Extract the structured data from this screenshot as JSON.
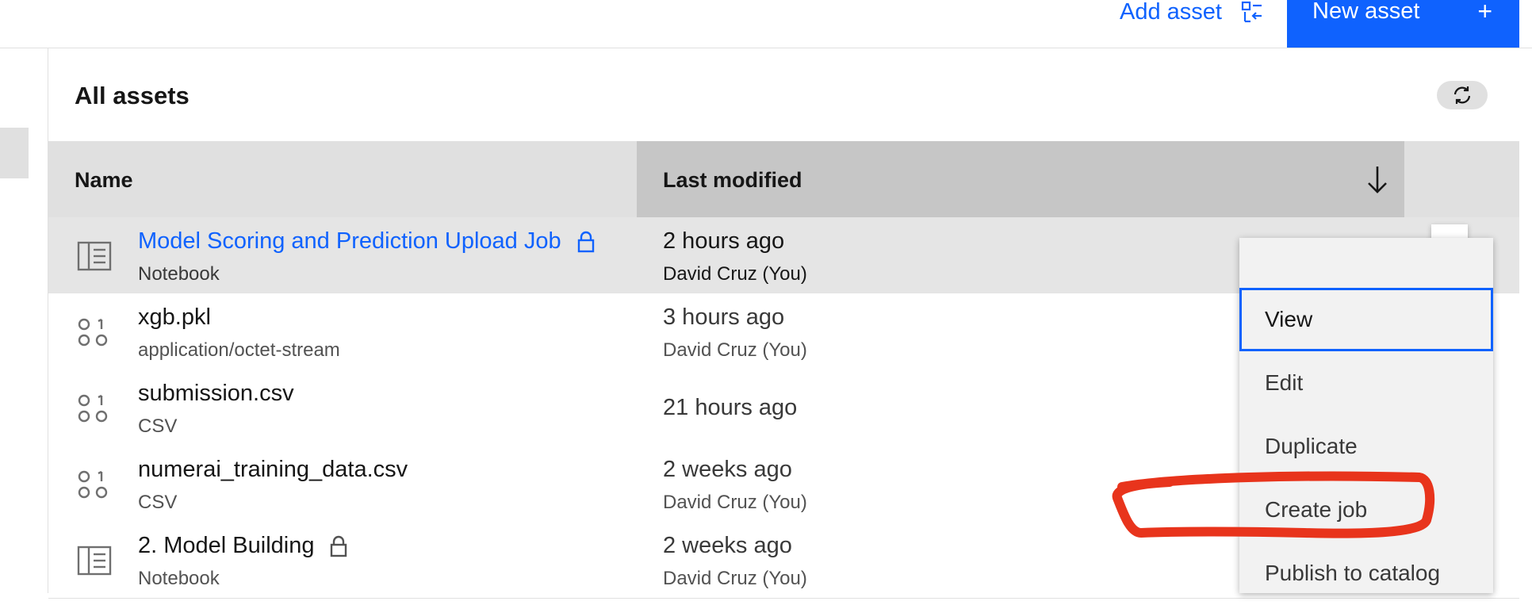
{
  "toolbar": {
    "add_asset_label": "Add asset",
    "new_asset_label": "New asset",
    "new_asset_icon": "plus-icon"
  },
  "section": {
    "title": "All assets",
    "refresh_icon": "refresh-icon"
  },
  "table": {
    "columns": [
      "Name",
      "Last modified"
    ],
    "sort": "descending",
    "rows": [
      {
        "name": "Model Scoring and Prediction Upload Job",
        "type": "Notebook",
        "modified": "2 hours ago",
        "modified_by": "David Cruz (You)",
        "locked": true,
        "icon": "notebook-icon"
      },
      {
        "name": "xgb.pkl",
        "type": "application/octet-stream",
        "modified": "3 hours ago",
        "modified_by": "David Cruz (You)",
        "locked": false,
        "icon": "data-asset-icon"
      },
      {
        "name": "submission.csv",
        "type": "CSV",
        "modified": "21 hours ago",
        "modified_by": "",
        "locked": false,
        "icon": "data-asset-icon"
      },
      {
        "name": "numerai_training_data.csv",
        "type": "CSV",
        "modified": "2 weeks ago",
        "modified_by": "David Cruz (You)",
        "locked": false,
        "icon": "data-asset-icon"
      },
      {
        "name": "2. Model Building",
        "type": "Notebook",
        "modified": "2 weeks ago",
        "modified_by": "David Cruz (You)",
        "locked": true,
        "icon": "notebook-icon"
      }
    ]
  },
  "overflow_menu": {
    "items": [
      "View",
      "Edit",
      "Duplicate",
      "Create job",
      "Publish to catalog"
    ],
    "focused": "View",
    "annotated": "Create job"
  },
  "colors": {
    "accent": "#0f62fe",
    "annotation": "#e8341c",
    "header_bg": "#e0e0e0",
    "sorted_header_bg": "#c6c6c6"
  }
}
